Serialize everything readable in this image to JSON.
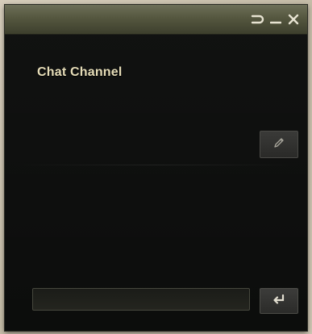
{
  "window": {
    "controls": {
      "back_icon": "undo-arrow-icon",
      "minimize_icon": "minimize-icon",
      "close_icon": "close-icon"
    }
  },
  "channel": {
    "title": "Chat Channel",
    "edit_icon": "pencil-icon"
  },
  "composer": {
    "input_value": "",
    "input_placeholder": "",
    "send_icon": "enter-return-icon"
  },
  "colors": {
    "titlebar": "#55573f",
    "background": "#0c0d0c",
    "heading_text": "#e6ddb8",
    "button": "#333331"
  }
}
